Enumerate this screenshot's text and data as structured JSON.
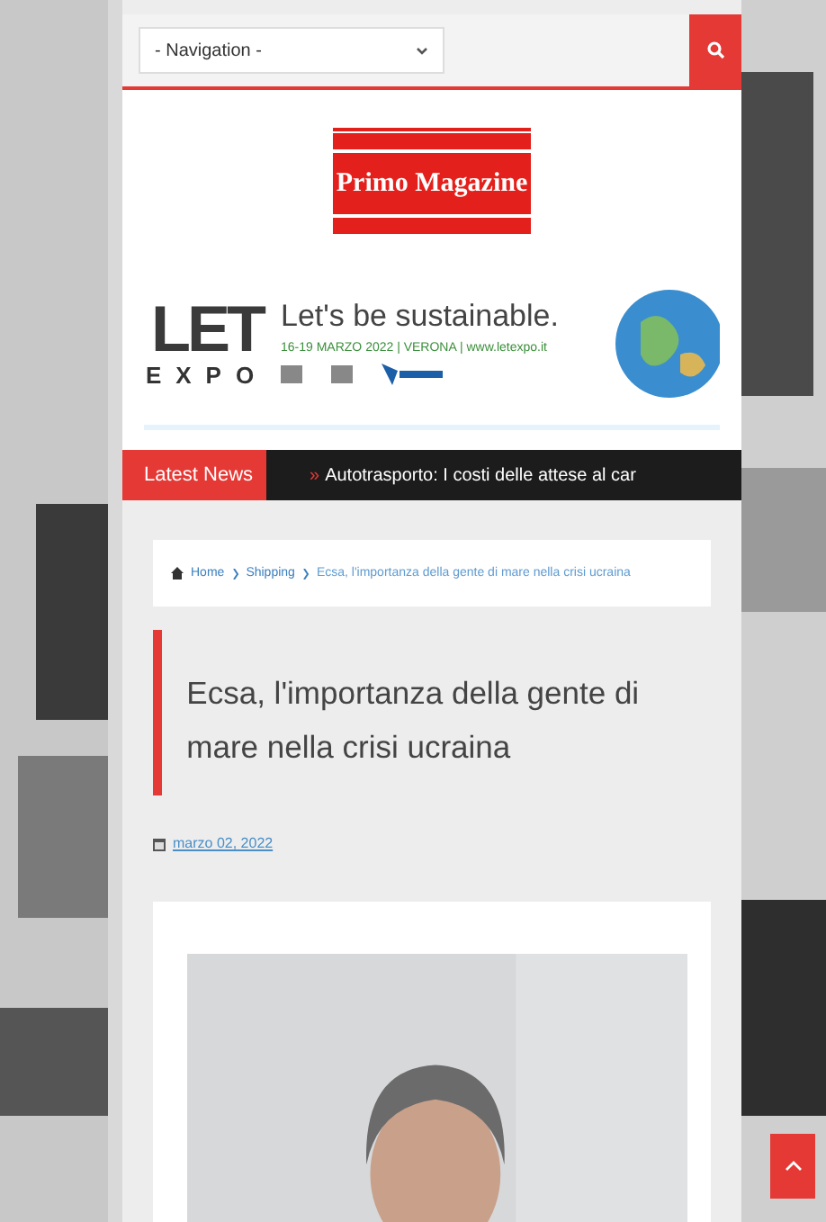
{
  "navigation": {
    "value": "- Navigation -"
  },
  "logo": {
    "text": "Primo Magazine"
  },
  "banner": {
    "brand_letters": "LET",
    "brand_word": "EXPO",
    "tagline": "Let's be sustainable.",
    "dates": "16-19 MARZO 2022 | VERONA | www.letexpo.it"
  },
  "ticker": {
    "label": "Latest News",
    "marker": "»",
    "headline": "Autotrasporto: I costi delle attese al car"
  },
  "breadcrumb": [
    {
      "label": "Home",
      "kind": "home"
    },
    {
      "label": "Shipping",
      "kind": "link"
    },
    {
      "label": "Ecsa, l'importanza della gente di mare nella crisi ucraina",
      "kind": "current"
    }
  ],
  "article": {
    "title": "Ecsa, l'importanza della gente di mare nella crisi ucraina",
    "date": "marzo 02, 2022"
  }
}
